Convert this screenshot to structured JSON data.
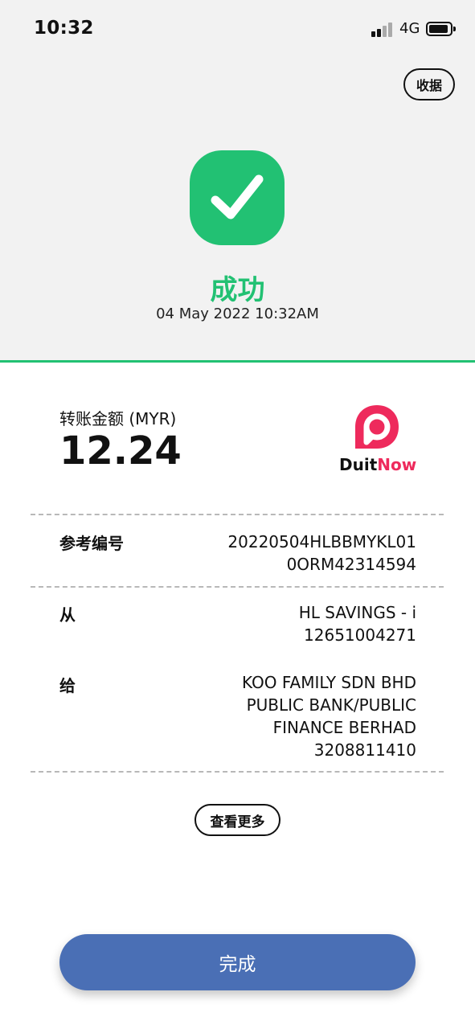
{
  "status_bar": {
    "time": "10:32",
    "network": "4G",
    "signal_icon": "signal-icon",
    "battery_icon": "battery-icon"
  },
  "header": {
    "receipt_label": "收据",
    "success_icon": "checkmark-icon",
    "success_title": "成功",
    "timestamp": "04 May 2022 10:32AM"
  },
  "amount": {
    "label": "转账金额 (MYR)",
    "value": "12.24",
    "brand_logo": "DuitNow",
    "brand_part1": "Duit",
    "brand_part2": "Now"
  },
  "details": [
    {
      "label": "参考编号",
      "value_lines": [
        "20220504HLBBMYKL01",
        "0ORM42314594"
      ]
    },
    {
      "label": "从",
      "value_lines": [
        "HL SAVINGS - i",
        "12651004271"
      ]
    },
    {
      "label": "给",
      "value_lines": [
        "KOO FAMILY SDN BHD",
        "PUBLIC BANK/PUBLIC",
        "FINANCE BERHAD",
        "3208811410"
      ]
    }
  ],
  "actions": {
    "view_more": "查看更多",
    "done": "完成"
  },
  "colors": {
    "success_green": "#22c173",
    "primary_blue": "#4a6fb5",
    "duitnow_pink": "#ee2a5c"
  }
}
